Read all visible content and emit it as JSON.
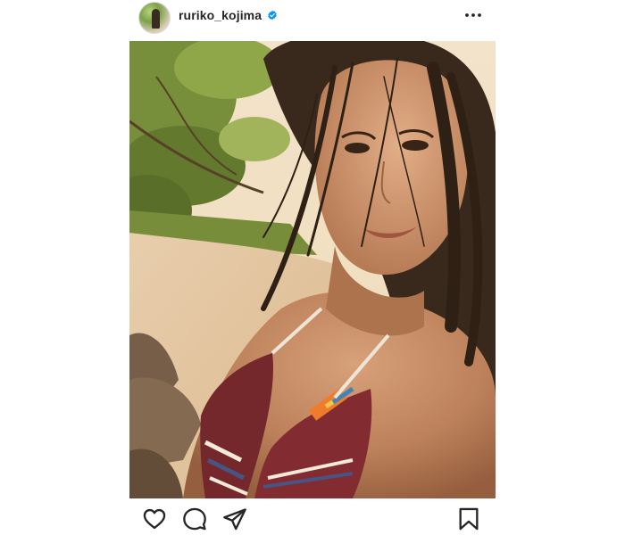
{
  "post": {
    "username": "ruriko_kojima",
    "verified": true,
    "avatar_icon": "profile-avatar",
    "more_icon": "more-horizontal-icon",
    "photo_description": "beach-selfie-photo"
  },
  "actions": {
    "like_icon": "heart-icon",
    "comment_icon": "comment-icon",
    "share_icon": "share-icon",
    "save_icon": "bookmark-icon"
  },
  "colors": {
    "text": "#262626",
    "verified_badge": "#0095f6",
    "icon": "#262626"
  }
}
